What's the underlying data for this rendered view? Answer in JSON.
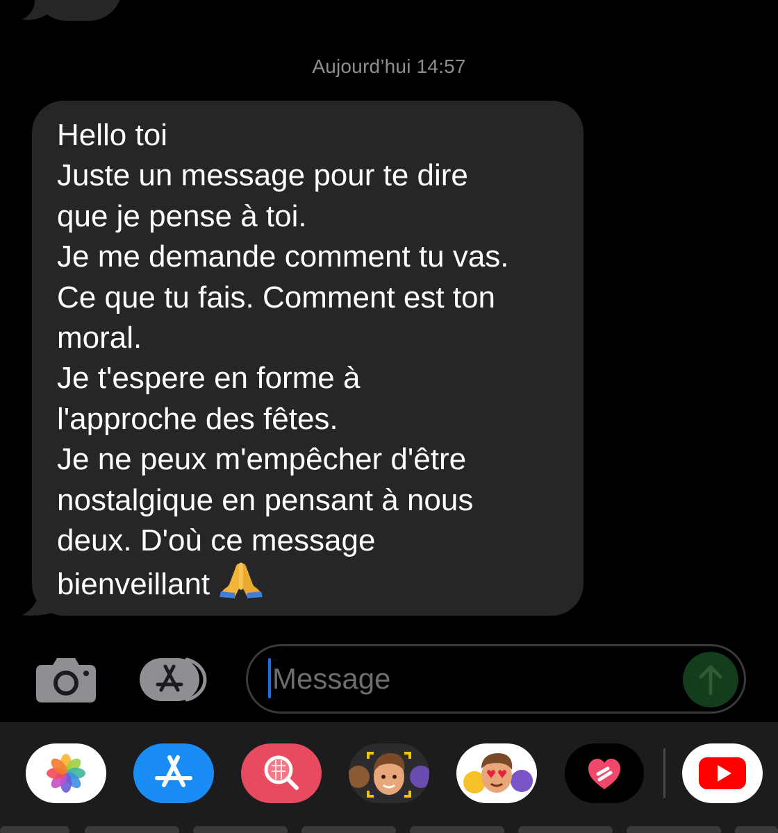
{
  "conversation": {
    "timestamp": "Aujourd’hui 14:57",
    "message_lines": [
      "Hello toi",
      "Juste un message pour te dire",
      "que je pense à toi.",
      "Je me demande comment tu vas.",
      "Ce que tu fais. Comment est ton",
      "moral.",
      "Je t'espere en forme à",
      "l'approche des fêtes.",
      "Je ne peux m'empêcher d'être",
      "nostalgique en pensant à nous",
      "deux. D'où ce message",
      "bienveillant"
    ],
    "message_emoji": "folded-hands-icon"
  },
  "composer": {
    "placeholder": "Message",
    "camera_icon": "camera-icon",
    "apps_icon": "app-store-icon",
    "send_icon": "arrow-up-icon"
  },
  "app_drawer": {
    "apps": [
      {
        "name": "photos-app-icon"
      },
      {
        "name": "app-store-app-icon"
      },
      {
        "name": "image-search-app-icon"
      },
      {
        "name": "memoji-app-icon"
      },
      {
        "name": "memoji-stickers-app-icon"
      },
      {
        "name": "digital-touch-app-icon"
      },
      {
        "name": "youtube-app-icon"
      }
    ]
  },
  "colors": {
    "background": "#000000",
    "bubble": "#262628",
    "timestamp": "#8e8e93",
    "drawer": "#1c1c1e",
    "caret": "#1d6ce0",
    "send_disabled": "#143d1c"
  }
}
